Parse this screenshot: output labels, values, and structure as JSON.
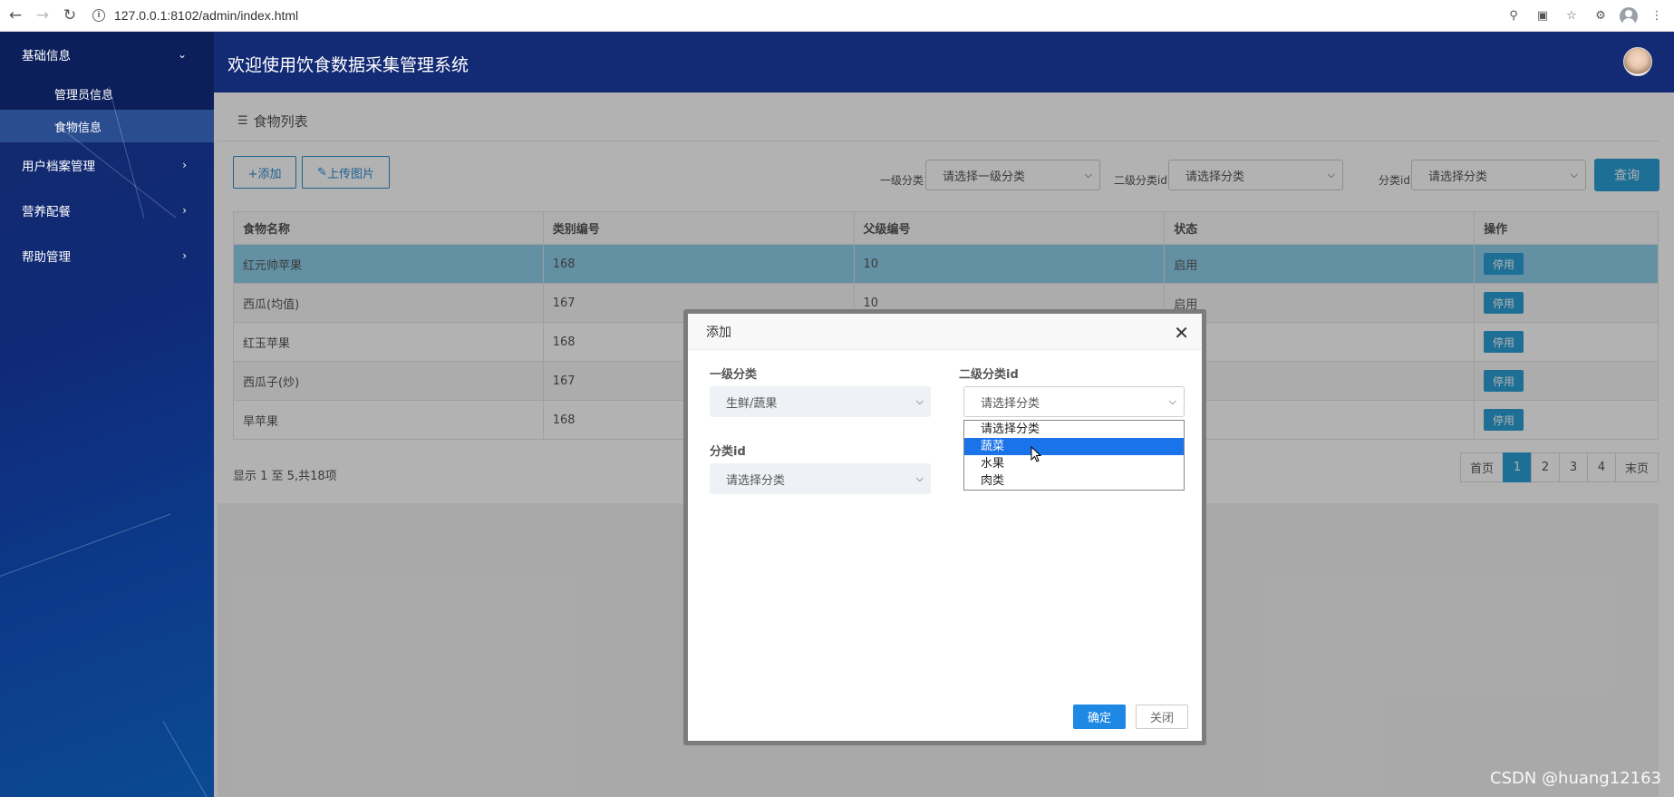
{
  "browser": {
    "url": "127.0.0.1:8102/admin/index.html",
    "back_icon": "arrow-left-icon",
    "forward_icon": "arrow-right-icon",
    "reload_icon": "reload-icon"
  },
  "sidebar": {
    "items": [
      {
        "label": "基础信息",
        "open": true,
        "subitems": [
          {
            "label": "管理员信息"
          },
          {
            "label": "食物信息",
            "active": true
          }
        ]
      },
      {
        "label": "用户档案管理"
      },
      {
        "label": "营养配餐"
      },
      {
        "label": "帮助管理"
      }
    ]
  },
  "header": {
    "title": "欢迎使用饮食数据采集管理系统"
  },
  "panel": {
    "title": "食物列表",
    "add_label": "+添加",
    "upload_label": "上传图片",
    "filters": {
      "level1_label": "一级分类",
      "level1_value": "请选择一级分类",
      "level2_label": "二级分类id",
      "level2_value": "请选择分类",
      "cat_label": "分类id",
      "cat_value": "请选择分类"
    },
    "query_label": "查询"
  },
  "table": {
    "headers": [
      "食物名称",
      "类别编号",
      "父级编号",
      "状态",
      "操作"
    ],
    "rows": [
      {
        "name": "红元帅苹果",
        "cat": "168",
        "parent": "10",
        "status": "启用",
        "action": "停用"
      },
      {
        "name": "西瓜(均值)",
        "cat": "167",
        "parent": "10",
        "status": "启用",
        "action": "停用"
      },
      {
        "name": "红玉苹果",
        "cat": "168",
        "parent": "",
        "status": "",
        "action": "停用"
      },
      {
        "name": "西瓜子(炒)",
        "cat": "167",
        "parent": "",
        "status": "",
        "action": "停用"
      },
      {
        "name": "旱苹果",
        "cat": "168",
        "parent": "",
        "status": "",
        "action": "停用"
      }
    ],
    "summary": "显示 1 至 5,共18项"
  },
  "pagination": {
    "first": "首页",
    "pages": [
      "1",
      "2",
      "3",
      "4"
    ],
    "current": "1",
    "last": "末页"
  },
  "modal": {
    "title": "添加",
    "level1_label": "一级分类",
    "level1_value": "生鲜/蔬果",
    "level2_label": "二级分类id",
    "level2_value": "请选择分类",
    "cat_label": "分类id",
    "cat_value": "请选择分类",
    "dropdown_options": [
      "请选择分类",
      "蔬菜",
      "水果",
      "肉类"
    ],
    "dropdown_selected": "蔬菜",
    "ok_label": "确定",
    "cancel_label": "关闭"
  },
  "watermark": "CSDN @huang12163"
}
